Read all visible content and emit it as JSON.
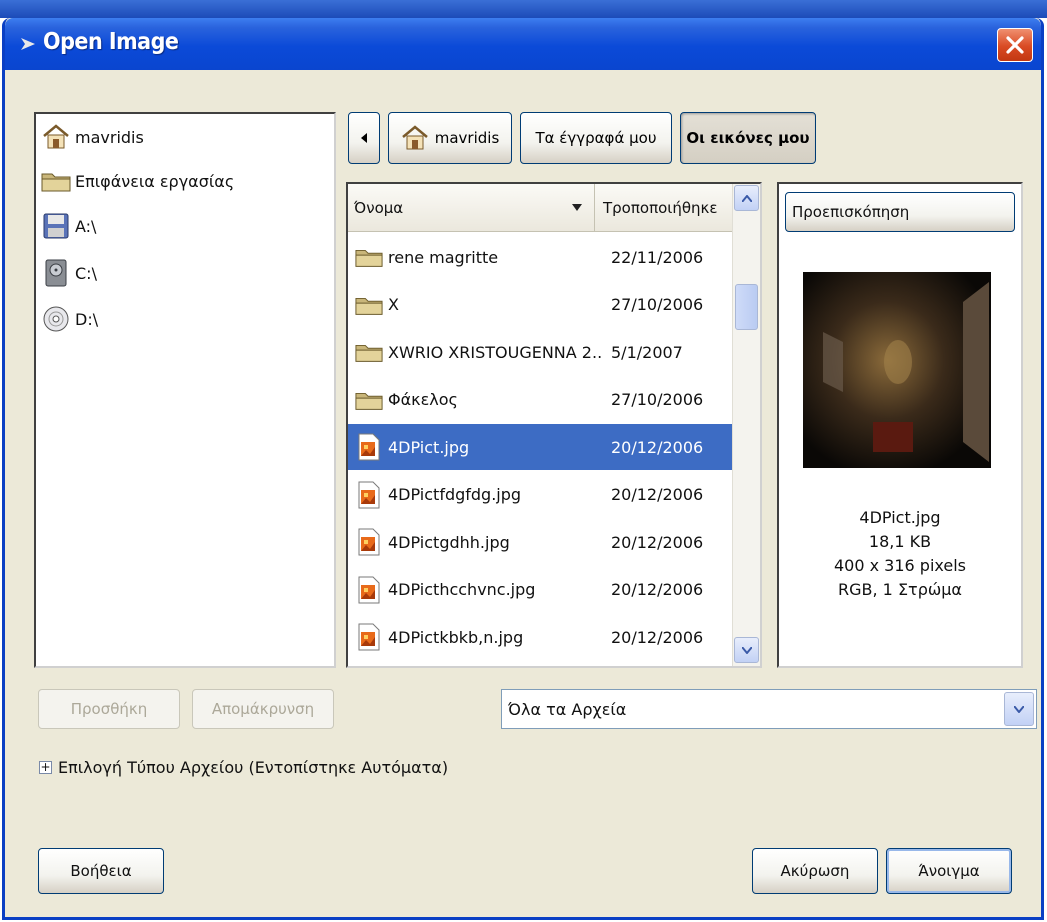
{
  "window": {
    "title": "Open Image"
  },
  "places": {
    "items": [
      {
        "label": "mavridis",
        "icon": "home-icon"
      },
      {
        "label": "Επιφάνεια εργασίας",
        "icon": "folder-icon"
      },
      {
        "label": "A:\\",
        "icon": "floppy-icon"
      },
      {
        "label": "C:\\",
        "icon": "harddisk-icon"
      },
      {
        "label": "D:\\",
        "icon": "cdrom-icon"
      }
    ]
  },
  "path_bar": {
    "home_label": "mavridis",
    "docs_label": "Τα έγγραφά μου",
    "pics_label": "Οι εικόνες μου"
  },
  "file_list": {
    "col_name": "Όνομα",
    "col_modified": "Τροποποιήθηκε",
    "rows": [
      {
        "name": "rene magritte",
        "date": "22/11/2006",
        "type": "folder"
      },
      {
        "name": "X",
        "date": "27/10/2006",
        "type": "folder"
      },
      {
        "name": "XWRIO XRISTOUGENNA 2...",
        "date": "5/1/2007",
        "type": "folder"
      },
      {
        "name": "Φάκελος",
        "date": "27/10/2006",
        "type": "folder"
      },
      {
        "name": "4DPict.jpg",
        "date": "20/12/2006",
        "type": "image",
        "selected": true
      },
      {
        "name": "4DPictfdgfdg.jpg",
        "date": "20/12/2006",
        "type": "image"
      },
      {
        "name": "4DPictgdhh.jpg",
        "date": "20/12/2006",
        "type": "image"
      },
      {
        "name": "4DPicthcchvnc.jpg",
        "date": "20/12/2006",
        "type": "image"
      },
      {
        "name": "4DPictkbkb,n.jpg",
        "date": "20/12/2006",
        "type": "image"
      }
    ]
  },
  "preview": {
    "header": "Προεπισκόπηση",
    "filename": "4DPict.jpg",
    "size": "18,1 KB",
    "dimensions": "400 x 316 pixels",
    "mode": "RGB, 1 Στρώμα"
  },
  "bookmarks": {
    "add_label": "Προσθήκη",
    "remove_label": "Απομάκρυνση"
  },
  "filter": {
    "selected": "Όλα τα Αρχεία"
  },
  "filetype": {
    "label": "Επιλογή Τύπου Αρχείου (Εντοπίστηκε Αυτόματα)"
  },
  "buttons": {
    "help": "Βοήθεια",
    "cancel": "Ακύρωση",
    "open": "Άνοιγμα"
  }
}
